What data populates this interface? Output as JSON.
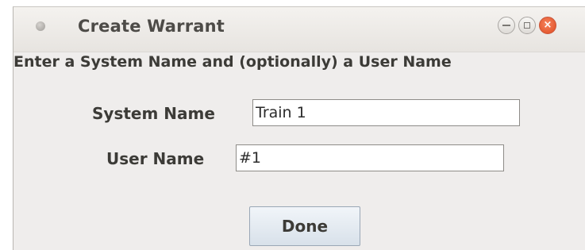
{
  "window": {
    "title": "Create Warrant"
  },
  "titlebar_buttons": {
    "minimize_icon": "minimize-icon",
    "maximize_icon": "maximize-icon",
    "close_icon": "close-icon",
    "close_glyph": "×"
  },
  "instructions": "Enter a System Name and (optionally) a User Name",
  "system_name": {
    "label": "System Name",
    "value": "Train 1"
  },
  "user_name": {
    "label": "User Name",
    "value": "#1"
  },
  "done_button": {
    "label": "Done"
  },
  "colors": {
    "close_button": "#df4a1f",
    "window_bg": "#efedec",
    "button_bg": "#d8e1ea"
  }
}
